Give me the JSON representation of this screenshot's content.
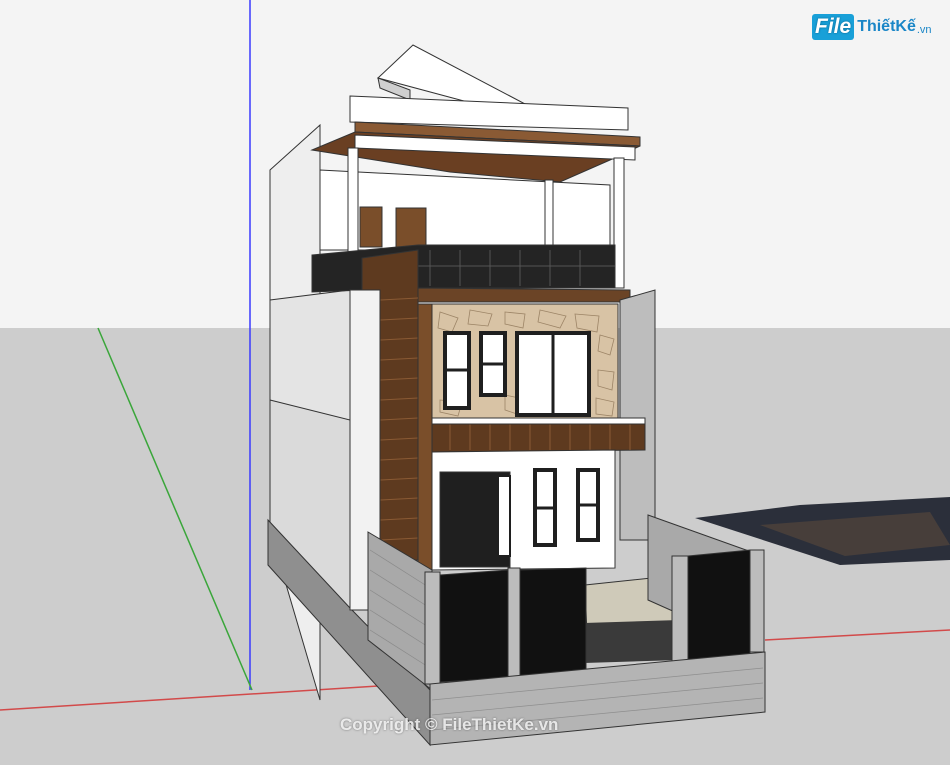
{
  "watermark": {
    "logo_file": "File",
    "logo_thiet": "Thiết",
    "logo_ke": "Kế",
    "logo_vn": ".vn",
    "copyright": "Copyright © FileThietKe.vn"
  },
  "colors": {
    "sky": "#f4f4f4",
    "ground": "#cdcdcd",
    "wall_white": "#ffffff",
    "wall_shade": "#dcdcdc",
    "timber": "#7a4e2a",
    "stone": "#d8c3a5",
    "dark": "#1f1f1f",
    "brick_gray": "#9a9a9a",
    "axis_blue": "#3a3aff",
    "axis_green": "#3aa63a",
    "axis_red": "#d24a4a"
  }
}
